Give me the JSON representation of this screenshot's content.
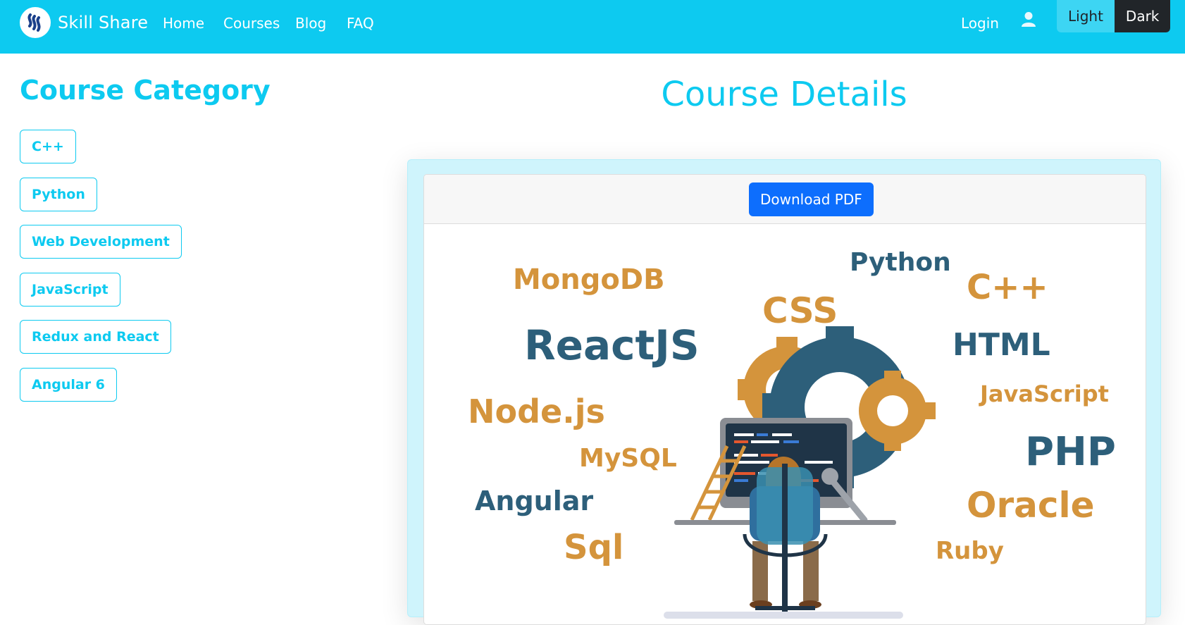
{
  "navbar": {
    "brand": "Skill Share",
    "links": [
      "Home",
      "Courses",
      "Blog",
      "FAQ"
    ],
    "login": "Login",
    "theme": {
      "light": "Light",
      "dark": "Dark"
    }
  },
  "sidebar": {
    "title": "Course Category",
    "categories": [
      "C++",
      "Python",
      "Web Development",
      "JavaScript",
      "Redux and React",
      "Angular 6"
    ]
  },
  "main": {
    "title": "Course Details",
    "download_label": "Download PDF",
    "illustration_words": [
      "MongoDB",
      "Python",
      "C++",
      "CSS",
      "ReactJS",
      "HTML",
      "JavaScript",
      "Node.js",
      "PHP",
      "MySQL",
      "Angular",
      "Oracle",
      "Sql",
      "Ruby"
    ]
  },
  "colors": {
    "accent": "#0dcaf0",
    "primary": "#0d6efd",
    "orange": "#d4943c",
    "navy": "#2d5f7a"
  }
}
